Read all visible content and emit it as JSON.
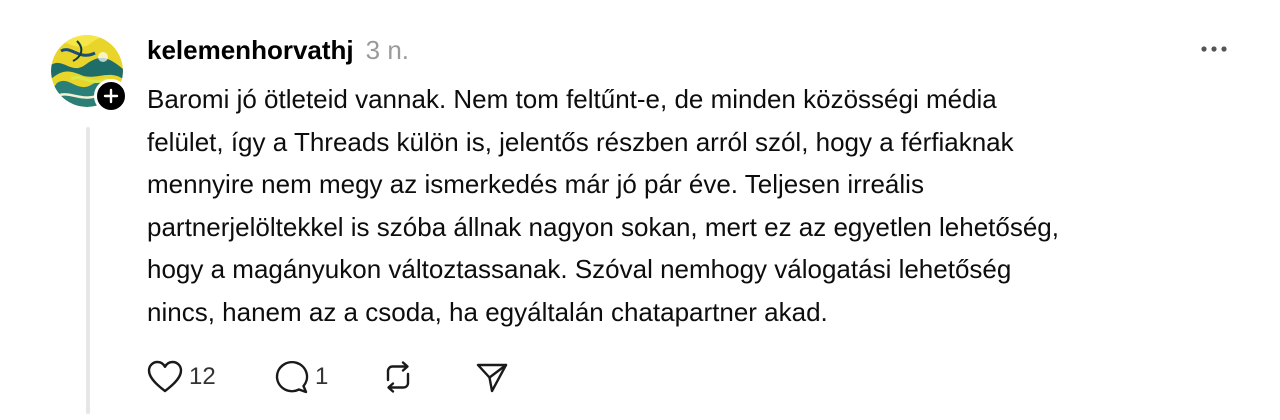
{
  "post": {
    "username": "kelemenhorvathj",
    "timestamp": "3 n.",
    "body_lines": [
      "Baromi jó ötleteid vannak. Nem tom feltűnt-e, de minden közösségi média",
      "felület, így a Threads külön is, jelentős részben arról szól, hogy a férfiaknak",
      "mennyire nem megy az ismerkedés már jó pár éve. Teljesen irreális",
      "partnerjelöltekkel is szóba állnak nagyon sokan, mert ez az egyetlen lehetőség,",
      "hogy a magányukon változtassanak. Szóval nemhogy válogatási lehetőség",
      "nincs, hanem az a csoda, ha egyáltalán chatapartner akad."
    ],
    "actions": {
      "like_count": "12",
      "reply_count": "1"
    }
  },
  "icons": {
    "avatar": "avatar-image",
    "follow": "plus-icon",
    "more": "more-horizontal-icon",
    "like": "heart-icon",
    "reply": "speech-bubble-icon",
    "repost": "repost-icon",
    "share": "send-icon"
  },
  "colors": {
    "text": "#000000",
    "muted": "#9a9a9a",
    "thread_line": "#e6e6e6",
    "avatar_yellow": "#f2dc2a",
    "avatar_teal": "#1f6f6a"
  }
}
